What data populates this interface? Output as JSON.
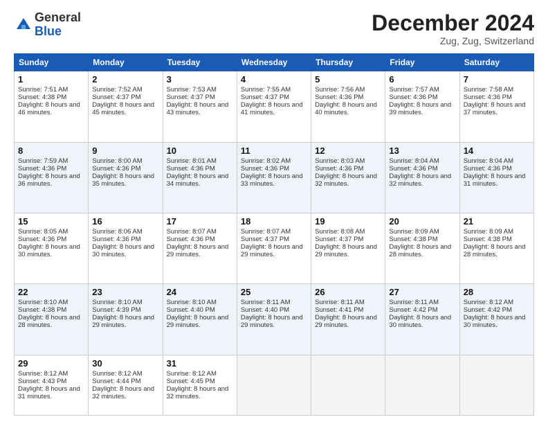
{
  "header": {
    "logo_line1": "General",
    "logo_line2": "Blue",
    "month": "December 2024",
    "location": "Zug, Zug, Switzerland"
  },
  "days_of_week": [
    "Sunday",
    "Monday",
    "Tuesday",
    "Wednesday",
    "Thursday",
    "Friday",
    "Saturday"
  ],
  "weeks": [
    [
      {
        "day": 1,
        "sunrise": "7:51 AM",
        "sunset": "4:38 PM",
        "daylight": "8 hours and 46 minutes."
      },
      {
        "day": 2,
        "sunrise": "7:52 AM",
        "sunset": "4:37 PM",
        "daylight": "8 hours and 45 minutes."
      },
      {
        "day": 3,
        "sunrise": "7:53 AM",
        "sunset": "4:37 PM",
        "daylight": "8 hours and 43 minutes."
      },
      {
        "day": 4,
        "sunrise": "7:55 AM",
        "sunset": "4:37 PM",
        "daylight": "8 hours and 41 minutes."
      },
      {
        "day": 5,
        "sunrise": "7:56 AM",
        "sunset": "4:36 PM",
        "daylight": "8 hours and 40 minutes."
      },
      {
        "day": 6,
        "sunrise": "7:57 AM",
        "sunset": "4:36 PM",
        "daylight": "8 hours and 39 minutes."
      },
      {
        "day": 7,
        "sunrise": "7:58 AM",
        "sunset": "4:36 PM",
        "daylight": "8 hours and 37 minutes."
      }
    ],
    [
      {
        "day": 8,
        "sunrise": "7:59 AM",
        "sunset": "4:36 PM",
        "daylight": "8 hours and 36 minutes."
      },
      {
        "day": 9,
        "sunrise": "8:00 AM",
        "sunset": "4:36 PM",
        "daylight": "8 hours and 35 minutes."
      },
      {
        "day": 10,
        "sunrise": "8:01 AM",
        "sunset": "4:36 PM",
        "daylight": "8 hours and 34 minutes."
      },
      {
        "day": 11,
        "sunrise": "8:02 AM",
        "sunset": "4:36 PM",
        "daylight": "8 hours and 33 minutes."
      },
      {
        "day": 12,
        "sunrise": "8:03 AM",
        "sunset": "4:36 PM",
        "daylight": "8 hours and 32 minutes."
      },
      {
        "day": 13,
        "sunrise": "8:04 AM",
        "sunset": "4:36 PM",
        "daylight": "8 hours and 32 minutes."
      },
      {
        "day": 14,
        "sunrise": "8:04 AM",
        "sunset": "4:36 PM",
        "daylight": "8 hours and 31 minutes."
      }
    ],
    [
      {
        "day": 15,
        "sunrise": "8:05 AM",
        "sunset": "4:36 PM",
        "daylight": "8 hours and 30 minutes."
      },
      {
        "day": 16,
        "sunrise": "8:06 AM",
        "sunset": "4:36 PM",
        "daylight": "8 hours and 30 minutes."
      },
      {
        "day": 17,
        "sunrise": "8:07 AM",
        "sunset": "4:36 PM",
        "daylight": "8 hours and 29 minutes."
      },
      {
        "day": 18,
        "sunrise": "8:07 AM",
        "sunset": "4:37 PM",
        "daylight": "8 hours and 29 minutes."
      },
      {
        "day": 19,
        "sunrise": "8:08 AM",
        "sunset": "4:37 PM",
        "daylight": "8 hours and 29 minutes."
      },
      {
        "day": 20,
        "sunrise": "8:09 AM",
        "sunset": "4:38 PM",
        "daylight": "8 hours and 28 minutes."
      },
      {
        "day": 21,
        "sunrise": "8:09 AM",
        "sunset": "4:38 PM",
        "daylight": "8 hours and 28 minutes."
      }
    ],
    [
      {
        "day": 22,
        "sunrise": "8:10 AM",
        "sunset": "4:38 PM",
        "daylight": "8 hours and 28 minutes."
      },
      {
        "day": 23,
        "sunrise": "8:10 AM",
        "sunset": "4:39 PM",
        "daylight": "8 hours and 29 minutes."
      },
      {
        "day": 24,
        "sunrise": "8:10 AM",
        "sunset": "4:40 PM",
        "daylight": "8 hours and 29 minutes."
      },
      {
        "day": 25,
        "sunrise": "8:11 AM",
        "sunset": "4:40 PM",
        "daylight": "8 hours and 29 minutes."
      },
      {
        "day": 26,
        "sunrise": "8:11 AM",
        "sunset": "4:41 PM",
        "daylight": "8 hours and 29 minutes."
      },
      {
        "day": 27,
        "sunrise": "8:11 AM",
        "sunset": "4:42 PM",
        "daylight": "8 hours and 30 minutes."
      },
      {
        "day": 28,
        "sunrise": "8:12 AM",
        "sunset": "4:42 PM",
        "daylight": "8 hours and 30 minutes."
      }
    ],
    [
      {
        "day": 29,
        "sunrise": "8:12 AM",
        "sunset": "4:43 PM",
        "daylight": "8 hours and 31 minutes."
      },
      {
        "day": 30,
        "sunrise": "8:12 AM",
        "sunset": "4:44 PM",
        "daylight": "8 hours and 32 minutes."
      },
      {
        "day": 31,
        "sunrise": "8:12 AM",
        "sunset": "4:45 PM",
        "daylight": "8 hours and 32 minutes."
      },
      null,
      null,
      null,
      null
    ]
  ]
}
